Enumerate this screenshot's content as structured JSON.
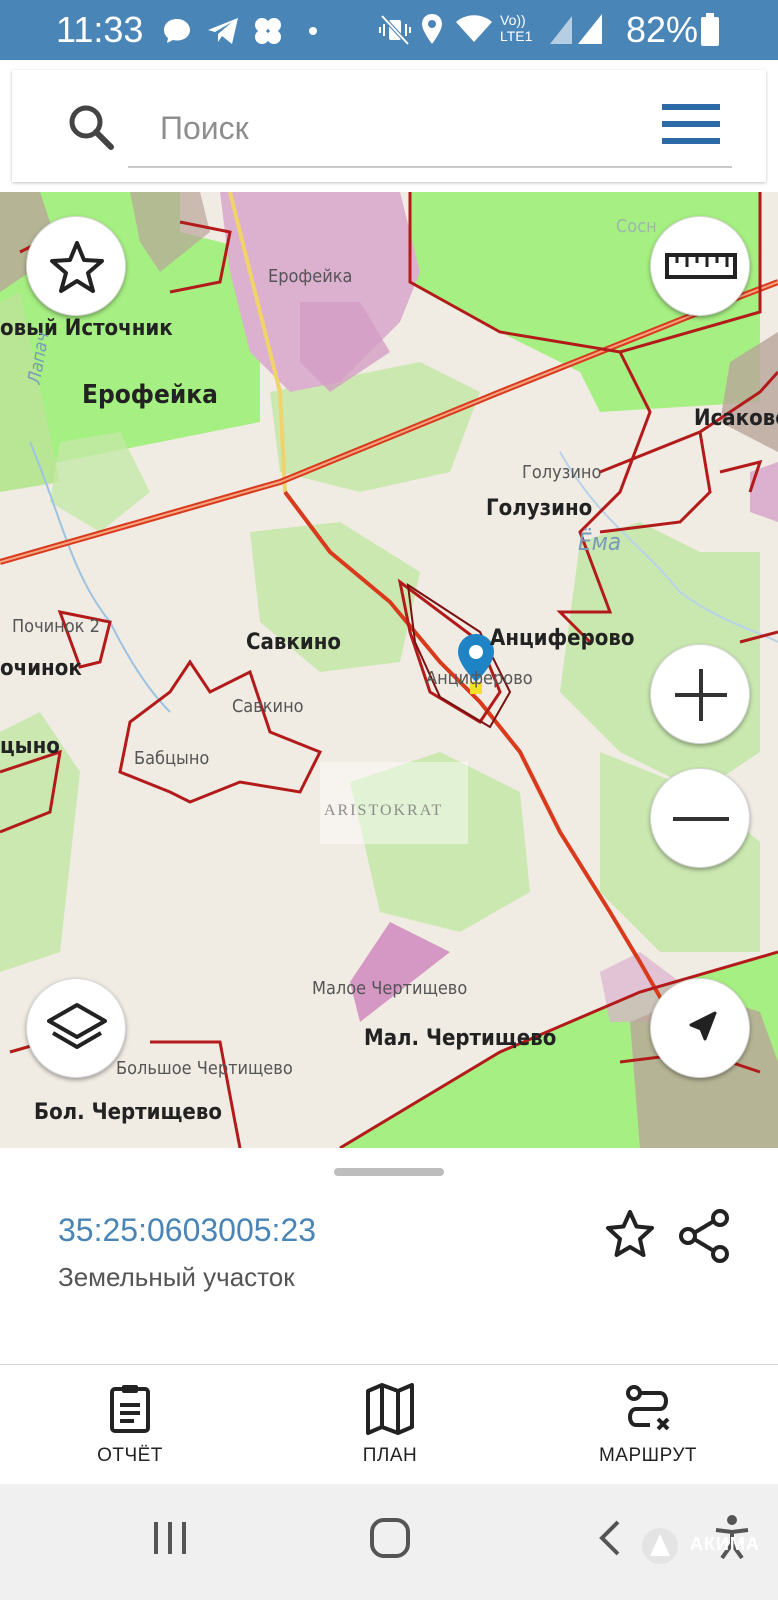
{
  "status_bar": {
    "time": "11:33",
    "network": "Vo)) LTE1",
    "battery": "82%",
    "icons": [
      "message-icon",
      "telegram-icon",
      "app-icon",
      "dot-icon",
      "mute-vibrate-icon",
      "location-icon",
      "wifi-icon",
      "signal-icon",
      "battery-icon"
    ]
  },
  "search": {
    "placeholder": "Поиск"
  },
  "map": {
    "labels": [
      {
        "text": "овый Источник",
        "style": "bold"
      },
      {
        "text": "Ерофейка",
        "style": "bold"
      },
      {
        "text": "Ерофейка",
        "style": "light"
      },
      {
        "text": "Лапач",
        "style": "water"
      },
      {
        "text": "Сосн",
        "style": "light"
      },
      {
        "text": "Исаково",
        "style": "bold"
      },
      {
        "text": "Голузино",
        "style": "light"
      },
      {
        "text": "Голузино",
        "style": "bold"
      },
      {
        "text": "Ёма",
        "style": "water"
      },
      {
        "text": "Починок 2",
        "style": "light"
      },
      {
        "text": "очинок",
        "style": "bold"
      },
      {
        "text": "Савкино",
        "style": "bold"
      },
      {
        "text": "Савкино",
        "style": "light"
      },
      {
        "text": "Анциферово",
        "style": "bold"
      },
      {
        "text": "Анциферово",
        "style": "light"
      },
      {
        "text": "цыно",
        "style": "bold"
      },
      {
        "text": "Бабцыно",
        "style": "light"
      },
      {
        "text": "Малое Чертищево",
        "style": "light"
      },
      {
        "text": "Мал. Чертищево",
        "style": "bold"
      },
      {
        "text": "Большое Чертищево",
        "style": "light"
      },
      {
        "text": "Бол. Чертищево",
        "style": "bold"
      }
    ],
    "watermark": "ARISTOKRAT",
    "buttons": [
      "favorites",
      "ruler",
      "zoom-in",
      "zoom-out",
      "layers",
      "my-location"
    ]
  },
  "object_panel": {
    "cadastral_number": "35:25:0603005:23",
    "type": "Земельный участок"
  },
  "bottom_nav": {
    "items": [
      {
        "label": "ОТЧЁТ",
        "icon": "report-icon"
      },
      {
        "label": "ПЛАН",
        "icon": "map-plan-icon"
      },
      {
        "label": "МАРШРУТ",
        "icon": "route-icon"
      }
    ]
  },
  "system_nav": {
    "buttons": [
      "recents",
      "home",
      "back",
      "accessibility"
    ],
    "watermark": "АКИМА"
  },
  "colors": {
    "accent": "#4a85b7",
    "boundary": "#b31b1b",
    "forest": "#a6ef82",
    "pink_zone": "#dcb0cf",
    "road": "#d93a1c"
  }
}
